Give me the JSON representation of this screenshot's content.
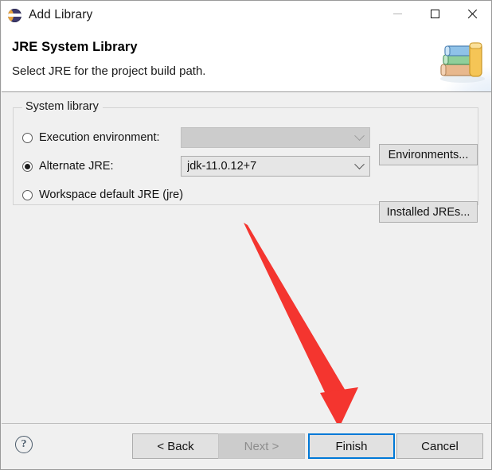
{
  "window": {
    "title": "Add Library",
    "app_icon": "eclipse-logo-icon",
    "controls": {
      "minimize": "minimize-icon",
      "maximize": "maximize-icon",
      "close": "close-icon"
    }
  },
  "header": {
    "title": "JRE System Library",
    "description": "Select JRE for the project build path.",
    "banner_icon": "books-stack-icon"
  },
  "group": {
    "legend": "System library",
    "rows": [
      {
        "radio_label": "Execution environment:",
        "selected": false,
        "combo_value": "",
        "combo_enabled": false,
        "button_label": "Environments..."
      },
      {
        "radio_label": "Alternate JRE:",
        "selected": true,
        "combo_value": "jdk-11.0.12+7",
        "combo_enabled": true,
        "button_label": "Installed JREs..."
      },
      {
        "radio_label": "Workspace default JRE (jre)",
        "selected": false
      }
    ]
  },
  "annotation": {
    "type": "arrow",
    "color": "#f4352f",
    "points_to": "finish-button"
  },
  "footer": {
    "help_icon": "help-question-icon",
    "help_glyph": "?",
    "buttons": [
      {
        "label": "< Back",
        "enabled": true,
        "focused": false
      },
      {
        "label": "Next >",
        "enabled": false,
        "focused": false
      },
      {
        "label": "Finish",
        "enabled": true,
        "focused": true
      },
      {
        "label": "Cancel",
        "enabled": true,
        "focused": false
      }
    ]
  },
  "colors": {
    "focus_blue": "#0078d7",
    "annotation_red": "#f4352f",
    "dialog_bg": "#f0f0f0",
    "control_bg": "#e1e1e1",
    "disabled_bg": "#cccccc"
  }
}
